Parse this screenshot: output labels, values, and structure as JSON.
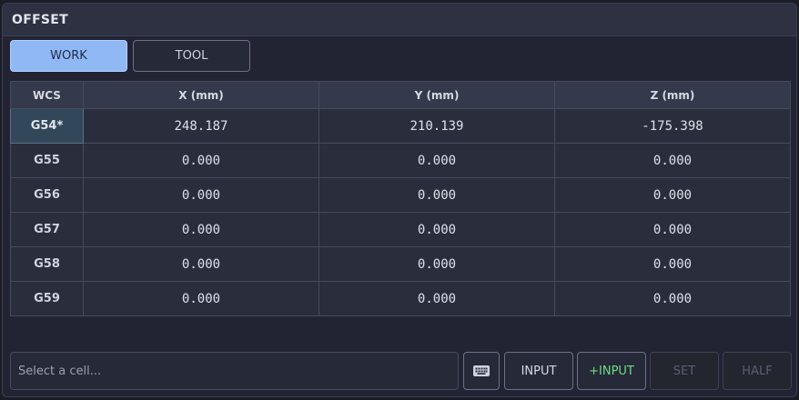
{
  "title": "OFFSET",
  "tabs": [
    {
      "label": "WORK",
      "active": true
    },
    {
      "label": "TOOL",
      "active": false
    }
  ],
  "table": {
    "headers": [
      "WCS",
      "X (mm)",
      "Y (mm)",
      "Z (mm)"
    ],
    "rows": [
      {
        "wcs": "G54*",
        "x": "248.187",
        "y": "210.139",
        "z": "-175.398",
        "active": true
      },
      {
        "wcs": "G55",
        "x": "0.000",
        "y": "0.000",
        "z": "0.000"
      },
      {
        "wcs": "G56",
        "x": "0.000",
        "y": "0.000",
        "z": "0.000"
      },
      {
        "wcs": "G57",
        "x": "0.000",
        "y": "0.000",
        "z": "0.000"
      },
      {
        "wcs": "G58",
        "x": "0.000",
        "y": "0.000",
        "z": "0.000"
      },
      {
        "wcs": "G59",
        "x": "0.000",
        "y": "0.000",
        "z": "0.000"
      }
    ]
  },
  "bottom": {
    "placeholder": "Select a cell...",
    "keyboard_icon": "keyboard-icon",
    "input_label": "INPUT",
    "plus_input_label": "+INPUT",
    "set_label": "SET",
    "half_label": "HALF"
  },
  "colors": {
    "accent": "#8fb8f5",
    "plus_input": "#6fdc87",
    "active_cell": "#33475a"
  }
}
